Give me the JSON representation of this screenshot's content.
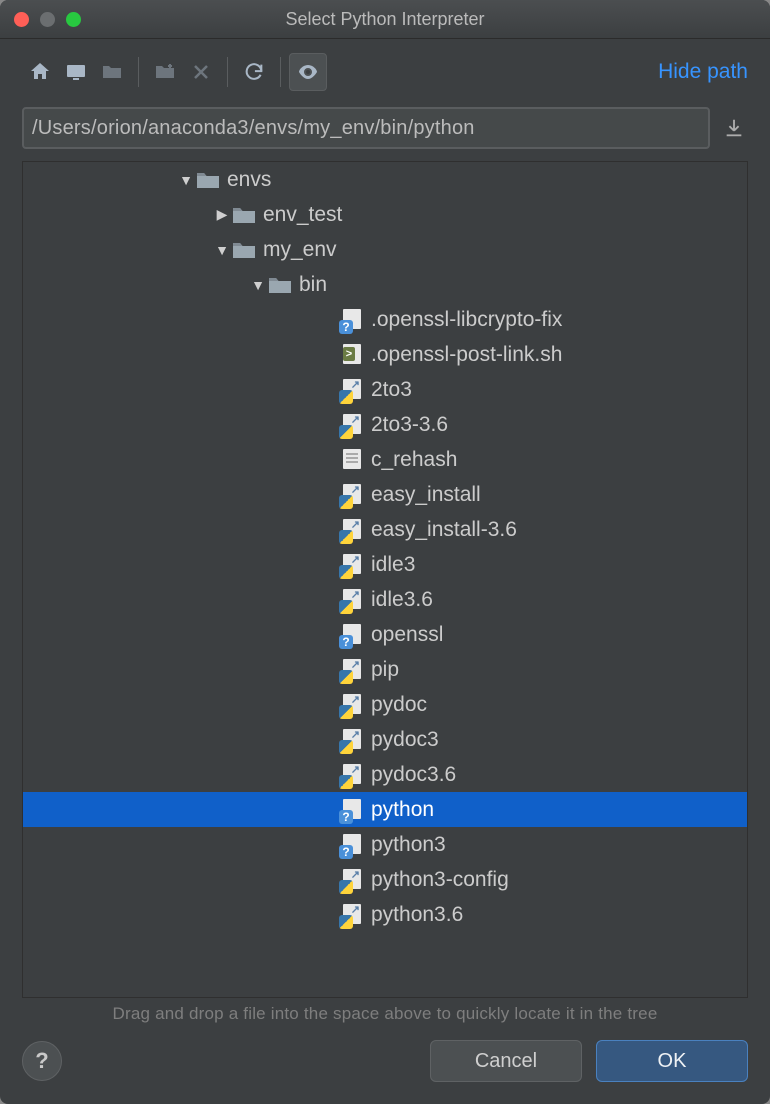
{
  "window": {
    "title": "Select Python Interpreter"
  },
  "toolbar": {
    "hide_path": "Hide path"
  },
  "path": {
    "value": "/Users/orion/anaconda3/envs/my_env/bin/python"
  },
  "hint": "Drag and drop a file into the space above to quickly locate it in the tree",
  "buttons": {
    "cancel": "Cancel",
    "ok": "OK",
    "help": "?"
  },
  "tree": [
    {
      "indent": 4,
      "arrow": "down",
      "icon": "folder",
      "label": "envs",
      "selected": false
    },
    {
      "indent": 5,
      "arrow": "right",
      "icon": "folder",
      "label": "env_test",
      "selected": false
    },
    {
      "indent": 5,
      "arrow": "down",
      "icon": "folder",
      "label": "my_env",
      "selected": false
    },
    {
      "indent": 6,
      "arrow": "down",
      "icon": "folder",
      "label": "bin",
      "selected": false
    },
    {
      "indent": 8,
      "arrow": "none",
      "icon": "unknown",
      "label": ".openssl-libcrypto-fix",
      "selected": false
    },
    {
      "indent": 8,
      "arrow": "none",
      "icon": "sh",
      "label": ".openssl-post-link.sh",
      "selected": false
    },
    {
      "indent": 8,
      "arrow": "none",
      "icon": "pyfile",
      "label": "2to3",
      "selected": false
    },
    {
      "indent": 8,
      "arrow": "none",
      "icon": "pyfile",
      "label": "2to3-3.6",
      "selected": false
    },
    {
      "indent": 8,
      "arrow": "none",
      "icon": "text",
      "label": "c_rehash",
      "selected": false
    },
    {
      "indent": 8,
      "arrow": "none",
      "icon": "pyfile",
      "label": "easy_install",
      "selected": false
    },
    {
      "indent": 8,
      "arrow": "none",
      "icon": "pyfile",
      "label": "easy_install-3.6",
      "selected": false
    },
    {
      "indent": 8,
      "arrow": "none",
      "icon": "pyfile",
      "label": "idle3",
      "selected": false
    },
    {
      "indent": 8,
      "arrow": "none",
      "icon": "pyfile",
      "label": "idle3.6",
      "selected": false
    },
    {
      "indent": 8,
      "arrow": "none",
      "icon": "unknown",
      "label": "openssl",
      "selected": false
    },
    {
      "indent": 8,
      "arrow": "none",
      "icon": "pyfile",
      "label": "pip",
      "selected": false
    },
    {
      "indent": 8,
      "arrow": "none",
      "icon": "pyfile",
      "label": "pydoc",
      "selected": false
    },
    {
      "indent": 8,
      "arrow": "none",
      "icon": "pyfile",
      "label": "pydoc3",
      "selected": false
    },
    {
      "indent": 8,
      "arrow": "none",
      "icon": "pyfile",
      "label": "pydoc3.6",
      "selected": false
    },
    {
      "indent": 8,
      "arrow": "none",
      "icon": "unknown",
      "label": "python",
      "selected": true
    },
    {
      "indent": 8,
      "arrow": "none",
      "icon": "unknown",
      "label": "python3",
      "selected": false
    },
    {
      "indent": 8,
      "arrow": "none",
      "icon": "pyfile",
      "label": "python3-config",
      "selected": false
    },
    {
      "indent": 8,
      "arrow": "none",
      "icon": "pyfile",
      "label": "python3.6",
      "selected": false
    }
  ]
}
